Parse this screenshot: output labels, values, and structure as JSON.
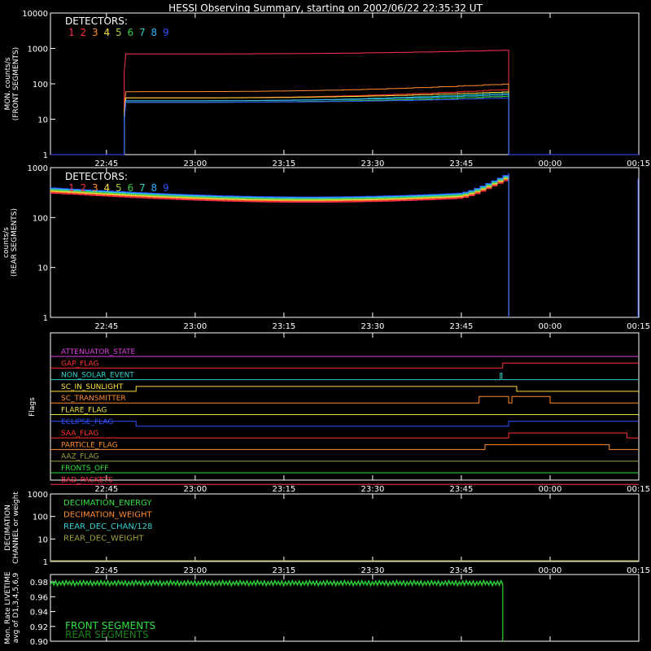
{
  "page_title": "HESSI Observing Summary, starting on 2002/06/22 22:35:32 UT",
  "colors": {
    "background": "#000000",
    "axes": "#ffffff",
    "det": [
      "#ff3050",
      "#ff3030",
      "#ff8c30",
      "#ffe040",
      "#a8d040",
      "#30d040",
      "#30d0c0",
      "#30b0ff",
      "#3050ff"
    ]
  },
  "time_ticks": [
    "22:45",
    "23:00",
    "23:15",
    "23:30",
    "23:45",
    "00:00",
    "00:15"
  ],
  "chart_data": [
    {
      "type": "line",
      "ylabel": "MON. counts/s\n(FRONT SEGMENTS)",
      "log": true,
      "ylim": [
        1,
        10000
      ],
      "yticks": [
        "1",
        "10",
        "100",
        "1000",
        "10000"
      ],
      "legend_title": "DETECTORS:",
      "legend_labels": [
        "1",
        "2",
        "3",
        "4",
        "5",
        "6",
        "7",
        "8",
        "9"
      ],
      "active_start": "22:48",
      "active_end": "23:53",
      "series": [
        {
          "name": "1",
          "start": 700,
          "end": 900
        },
        {
          "name": "2",
          "start": 40,
          "end": 70
        },
        {
          "name": "3",
          "start": 60,
          "end": 100
        },
        {
          "name": "4",
          "start": 40,
          "end": 60
        },
        {
          "name": "5",
          "start": 30,
          "end": 45
        },
        {
          "name": "6",
          "start": 30,
          "end": 45
        },
        {
          "name": "7",
          "start": 33,
          "end": 55
        },
        {
          "name": "8",
          "start": 33,
          "end": 50
        },
        {
          "name": "9",
          "start": 30,
          "end": 40
        }
      ]
    },
    {
      "type": "line",
      "ylabel": "counts/s\n(REAR SEGMENTS)",
      "log": true,
      "ylim": [
        1,
        1000
      ],
      "yticks": [
        "1",
        "10",
        "100",
        "1000"
      ],
      "legend_title": "DETECTORS:",
      "legend_labels": [
        "1",
        "2",
        "3",
        "4",
        "5",
        "6",
        "7",
        "8",
        "9"
      ],
      "series_level": [
        350,
        220,
        700
      ]
    },
    {
      "type": "line",
      "ylabel": "Flags",
      "flags": [
        {
          "label": "ATTENUATOR_STATE",
          "color": "#e040e0"
        },
        {
          "label": "GAP_FLAG",
          "color": "#ff3030"
        },
        {
          "label": "NON_SOLAR_EVENT",
          "color": "#30d0d0"
        },
        {
          "label": "SC_IN_SUNLIGHT",
          "color": "#ffe040"
        },
        {
          "label": "SC_TRANSMITTER",
          "color": "#ff8c30"
        },
        {
          "label": "FLARE_FLAG",
          "color": "#e8e040"
        },
        {
          "label": "ECLIPSE_FLAG",
          "color": "#3050ff"
        },
        {
          "label": "SAA_FLAG",
          "color": "#ff3030"
        },
        {
          "label": "PARTICLE_FLAG",
          "color": "#ff9030"
        },
        {
          "label": "AAZ_FLAG",
          "color": "#a0a040"
        },
        {
          "label": "FRONTS_OFF",
          "color": "#30e040"
        },
        {
          "label": "BAD_PACKETS",
          "color": "#ff3050"
        }
      ]
    },
    {
      "type": "line",
      "ylabel": "DECIMATION\nCHANNEL or weight",
      "log": true,
      "ylim": [
        1,
        1000
      ],
      "yticks": [
        "1",
        "10",
        "100",
        "1000"
      ],
      "legend": [
        {
          "label": "DECIMATION_ENERGY",
          "color": "#30e040"
        },
        {
          "label": "DECIMATION_WEIGHT",
          "color": "#ff8c30"
        },
        {
          "label": "REAR_DEC_CHAN/128",
          "color": "#30d0d0"
        },
        {
          "label": "REAR_DEC_WEIGHT",
          "color": "#a0a040"
        }
      ]
    },
    {
      "type": "line",
      "ylabel": "Mon. Rate LIVETIME\navg of D1,3,4,5,6,9",
      "log": false,
      "ylim": [
        0.9,
        0.99
      ],
      "yticks": [
        "0.90",
        "0.92",
        "0.94",
        "0.96",
        "0.98"
      ],
      "legend": [
        {
          "label": "FRONT SEGMENTS",
          "color": "#30e040"
        },
        {
          "label": "REAR SEGMENTS",
          "color": "#208020"
        }
      ],
      "series": [
        {
          "name": "FRONT SEGMENTS",
          "value": 0.979
        },
        {
          "name": "REAR SEGMENTS",
          "value": 0.977
        }
      ]
    }
  ]
}
